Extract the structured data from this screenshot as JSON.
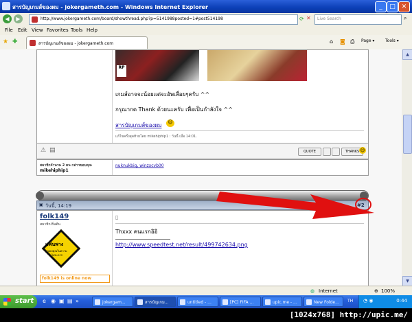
{
  "window": {
    "title": "สารบัญเกมส์ของผม - jokergameth.com - Windows Internet Explorer",
    "minimize": "_",
    "maximize": "□",
    "close": "✕"
  },
  "address": {
    "url": "http://www.jokergameth.com/board/showthread.php?p=5141988posted=1#post514198",
    "search_placeholder": "Live Search"
  },
  "menu": [
    "File",
    "Edit",
    "View",
    "Favorites",
    "Tools",
    "Help"
  ],
  "tab": {
    "label": "สารบัญเกมส์ของผม - jokergameth.com",
    "tools": [
      "Page ▾",
      "Tools ▾"
    ]
  },
  "post1": {
    "line1": "เกมส์อาจจะน้อยแต่จะอัพเลื่อยๆครับ ^^",
    "line2": "กรุณากด Thank ด้วยนะครับ เพื่อเป็นกำลังใจ ^^",
    "link": "สารบัญเกมส์ของผม",
    "edit_note": "แก้ไขครั้งสุดท้ายโดย mikehiphip1 : วันนี้ เมื่อ 14:01.",
    "quote_btn": "QUOTE",
    "thanks_btn": "THANKS",
    "thanks_info": "สมาชิกจำนวน 2 คน กล่าวขอบคุณ",
    "thanks_user": "mikehiphip1",
    "thanked_users": "nuknukbig, winzxcvb00"
  },
  "post2": {
    "date": "วันนี้, 14:19",
    "number": "#2",
    "username": "folk149",
    "rank": "สมาชิกเริ่มต้น",
    "avatar_text1": "แฟนพาง",
    "avatar_text2": "ขอบคุณในความ",
    "avatar_text3": "ไม่ละจาก",
    "online": "folk149 is online now",
    "text": "Thxxx คนแรกอิอิ",
    "link": "http://www.speedtest.net/result/499742634.png"
  },
  "status": {
    "zone": "Internet",
    "zoom": "100%"
  },
  "taskbar": {
    "start": "start",
    "tasks": [
      "jokergam...",
      "สารบัญเกม...",
      "untitled - ...",
      "[PC] FIFA ...",
      "upic.me - ...",
      "New Folde...",
      "TH"
    ],
    "clock": "0:44"
  },
  "watermark": "[1024x768] http://upic.me/",
  "colors": {
    "arrow": "#e01010",
    "titlebar": "#0b3fb6",
    "link": "#1a0dab",
    "online": "#f29a1b"
  }
}
